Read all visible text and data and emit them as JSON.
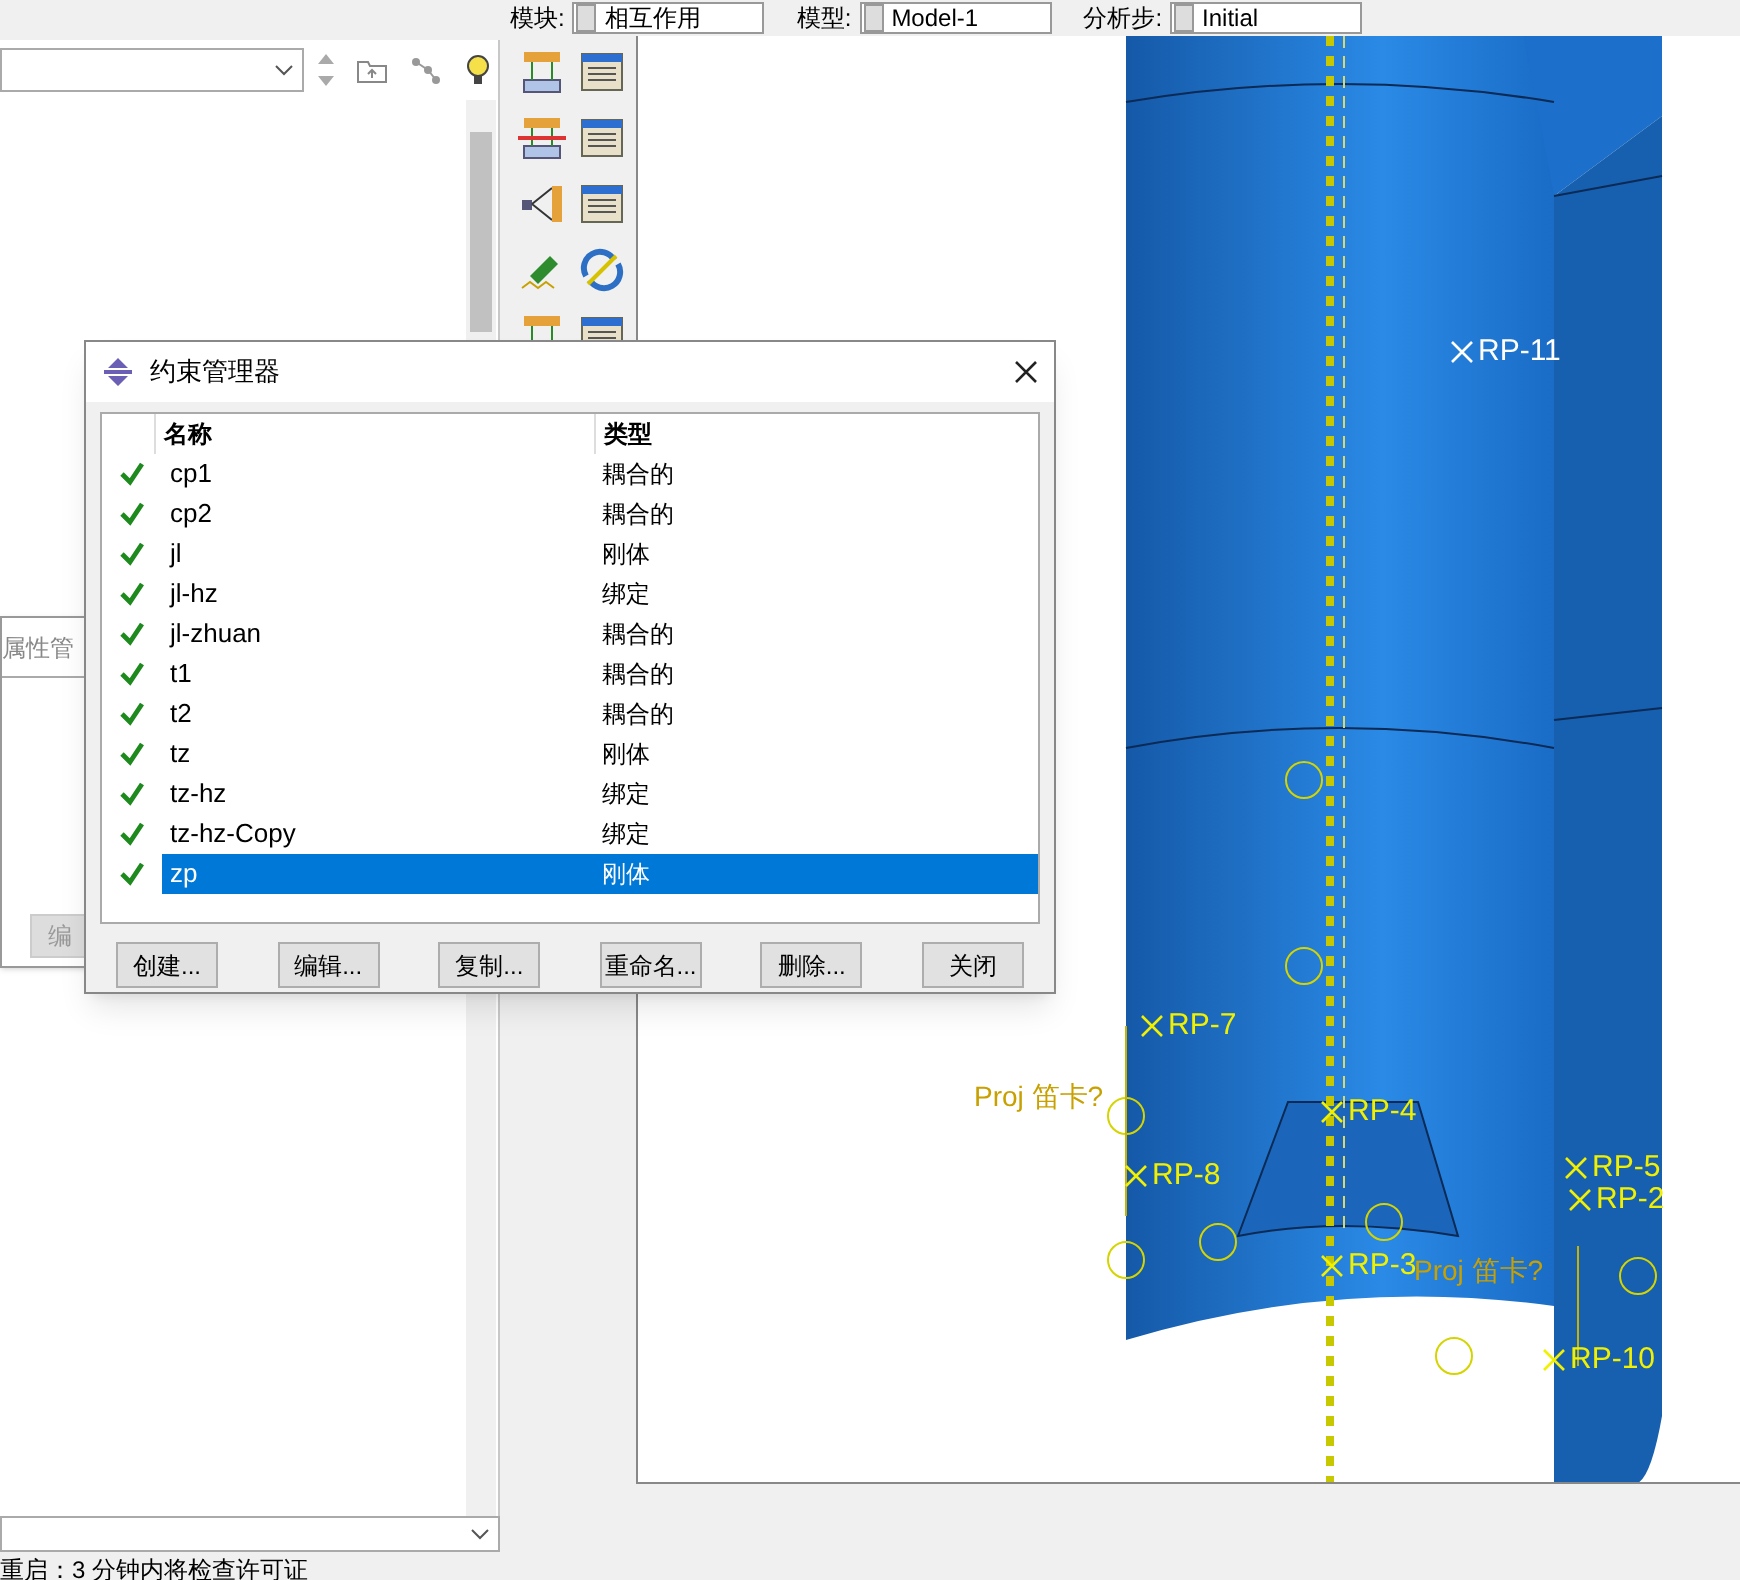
{
  "context_bar": [
    {
      "label": "模块:",
      "value": "相互作用"
    },
    {
      "label": "模型:",
      "value": "Model-1"
    },
    {
      "label": "分析步:",
      "value": "Initial"
    }
  ],
  "background_window": {
    "title": "属性管",
    "button": "编"
  },
  "dialog": {
    "title": "约束管理器",
    "columns": [
      "名称",
      "类型"
    ],
    "rows": [
      {
        "name": "cp1",
        "type": "耦合的",
        "active": true,
        "selected": false
      },
      {
        "name": "cp2",
        "type": "耦合的",
        "active": true,
        "selected": false
      },
      {
        "name": "jl",
        "type": "刚体",
        "active": true,
        "selected": false
      },
      {
        "name": "jl-hz",
        "type": "绑定",
        "active": true,
        "selected": false
      },
      {
        "name": "jl-zhuan",
        "type": "耦合的",
        "active": true,
        "selected": false
      },
      {
        "name": "t1",
        "type": "耦合的",
        "active": true,
        "selected": false
      },
      {
        "name": "t2",
        "type": "耦合的",
        "active": true,
        "selected": false
      },
      {
        "name": "tz",
        "type": "刚体",
        "active": true,
        "selected": false
      },
      {
        "name": "tz-hz",
        "type": "绑定",
        "active": true,
        "selected": false
      },
      {
        "name": "tz-hz-Copy",
        "type": "绑定",
        "active": true,
        "selected": false
      },
      {
        "name": "zp",
        "type": "刚体",
        "active": true,
        "selected": true
      }
    ],
    "buttons": [
      "创建...",
      "编辑...",
      "复制...",
      "重命名...",
      "删除...",
      "关闭"
    ]
  },
  "viewport": {
    "labels": [
      {
        "text": "RP-11",
        "kind": "point"
      },
      {
        "text": "RP-7",
        "kind": "symbol"
      },
      {
        "text": "Proj 笛卡?",
        "kind": "csys"
      },
      {
        "text": "RP-4",
        "kind": "symbol"
      },
      {
        "text": "RP-8",
        "kind": "symbol"
      },
      {
        "text": "RP-5",
        "kind": "symbol"
      },
      {
        "text": "RP-2",
        "kind": "symbol"
      },
      {
        "text": "RP-3",
        "kind": "symbol"
      },
      {
        "text": "Proj 笛卡?",
        "kind": "csys"
      },
      {
        "text": "RP-10",
        "kind": "symbol"
      }
    ]
  },
  "status_bar": "重启：3 分钟内将检查许可证"
}
